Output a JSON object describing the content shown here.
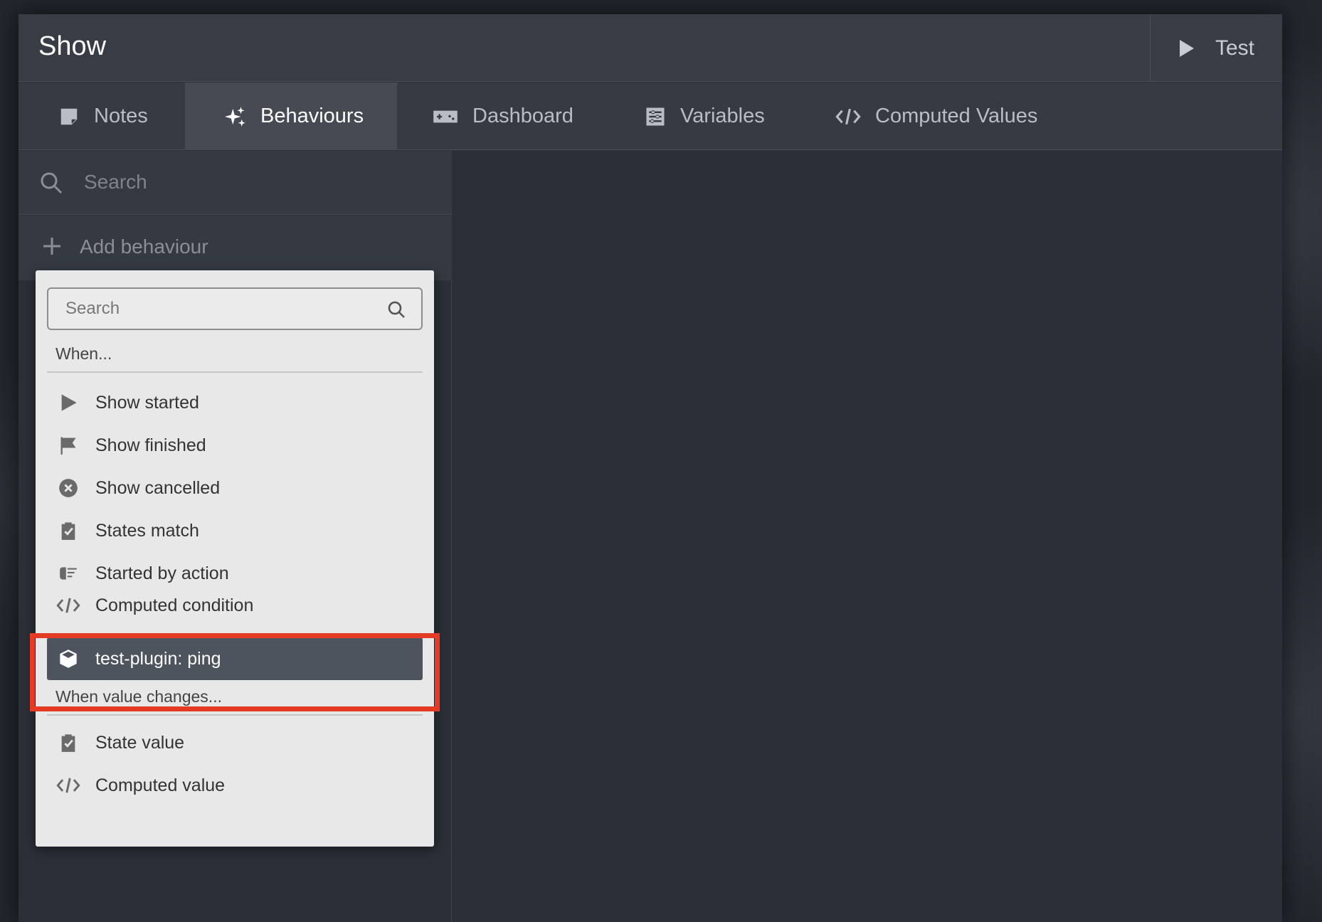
{
  "window": {
    "title": "Show",
    "test_label": "Test"
  },
  "tabs": [
    {
      "label": "Notes",
      "icon": "note-icon",
      "active": false
    },
    {
      "label": "Behaviours",
      "icon": "sparkle-icon",
      "active": true
    },
    {
      "label": "Dashboard",
      "icon": "gamepad-icon",
      "active": false
    },
    {
      "label": "Variables",
      "icon": "sliders-icon",
      "active": false
    },
    {
      "label": "Computed Values",
      "icon": "code-icon",
      "active": false
    }
  ],
  "sidebar": {
    "search_placeholder": "Search",
    "add_label": "Add behaviour"
  },
  "dropdown": {
    "search_placeholder": "Search",
    "sections": [
      {
        "header": "When...",
        "items": [
          {
            "label": "Show started",
            "icon": "play-icon"
          },
          {
            "label": "Show finished",
            "icon": "flag-icon"
          },
          {
            "label": "Show cancelled",
            "icon": "cancel-circle-icon"
          },
          {
            "label": "States match",
            "icon": "clipboard-check-icon"
          },
          {
            "label": "Started by action",
            "icon": "hand-pointer-icon"
          },
          {
            "label": "Computed condition",
            "icon": "code-icon"
          },
          {
            "label": "test-plugin: ping",
            "icon": "cube-icon",
            "selected": true
          }
        ]
      },
      {
        "header": "When value changes...",
        "items": [
          {
            "label": "State value",
            "icon": "clipboard-check-icon"
          },
          {
            "label": "Computed value",
            "icon": "code-icon"
          }
        ]
      }
    ]
  },
  "colors": {
    "highlight_border": "#e53a24",
    "selected_bg": "#4e545d",
    "dropdown_bg": "#e8e8e8"
  }
}
